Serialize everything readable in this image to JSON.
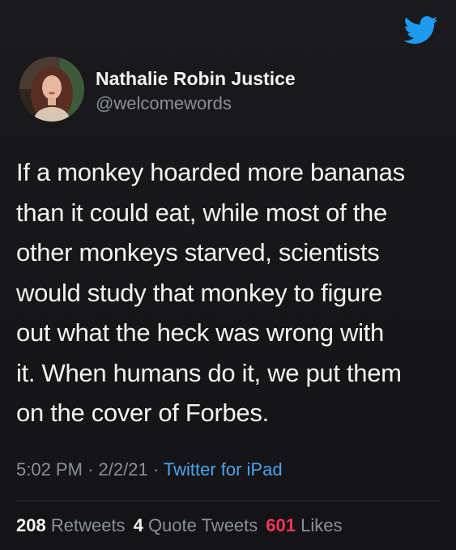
{
  "tweet": {
    "author": {
      "display_name": "Nathalie Robin Justice",
      "handle": "@welcomewords"
    },
    "text_lines": [
      "If a monkey hoarded more bananas",
      "than it could eat, while most of the",
      "other monkeys starved, scientists",
      "would study that monkey to figure",
      "out what the heck was wrong with",
      "it. When humans do it, we put them",
      "on the cover of Forbes."
    ],
    "time": "5:02 PM",
    "date": "2/2/21",
    "separator": "·",
    "source": "Twitter for iPad",
    "stats": {
      "retweets_count": "208",
      "retweets_label": "Retweets",
      "quote_count": "4",
      "quote_label": "Quote Tweets",
      "likes_count": "601",
      "likes_label": "Likes"
    }
  },
  "icons": {
    "brand": "twitter-bird-icon"
  },
  "colors": {
    "background": "#151517",
    "brand_blue": "#1d9bf0",
    "link_blue": "#4aa3ef",
    "likes_red": "#f0355a",
    "secondary_text": "#8b9096"
  }
}
